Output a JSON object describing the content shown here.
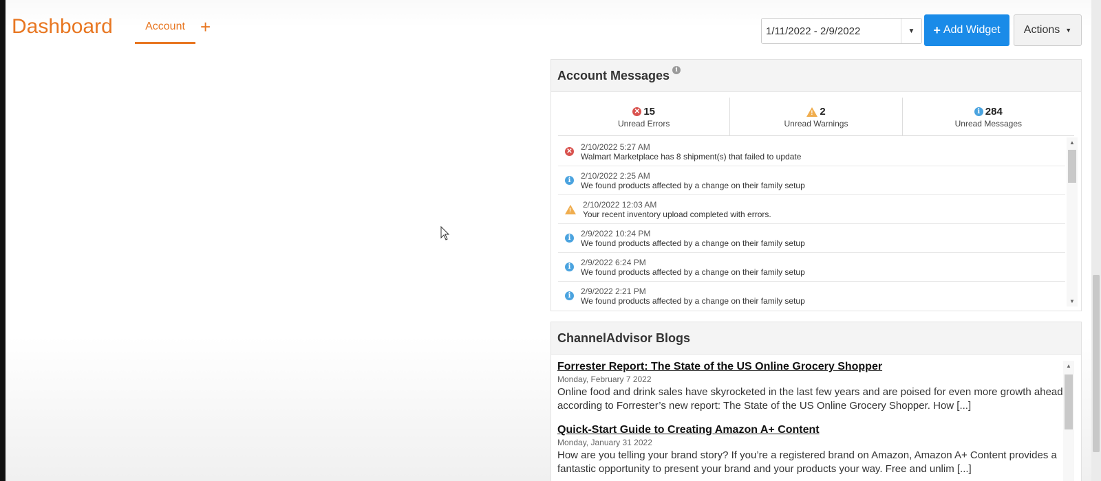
{
  "header": {
    "title": "Dashboard",
    "tab_label": "Account",
    "add_tab_symbol": "+",
    "date_range": "1/11/2022 - 2/9/2022",
    "add_widget_label": "Add Widget",
    "actions_label": "Actions"
  },
  "account_messages": {
    "title": "Account Messages",
    "stats": [
      {
        "icon": "error-icon",
        "count": "15",
        "label": "Unread Errors"
      },
      {
        "icon": "warning-icon",
        "count": "2",
        "label": "Unread Warnings"
      },
      {
        "icon": "info-icon",
        "count": "284",
        "label": "Unread Messages"
      }
    ],
    "messages": [
      {
        "type": "error",
        "date": "2/10/2022 5:27 AM",
        "text": "Walmart Marketplace has 8 shipment(s) that failed to update"
      },
      {
        "type": "info",
        "date": "2/10/2022 2:25 AM",
        "text": "We found products affected by a change on their family setup"
      },
      {
        "type": "warning",
        "date": "2/10/2022 12:03 AM",
        "text": "Your recent inventory upload completed with errors."
      },
      {
        "type": "info",
        "date": "2/9/2022 10:24 PM",
        "text": "We found products affected by a change on their family setup"
      },
      {
        "type": "info",
        "date": "2/9/2022 6:24 PM",
        "text": "We found products affected by a change on their family setup"
      },
      {
        "type": "info",
        "date": "2/9/2022 2:21 PM",
        "text": "We found products affected by a change on their family setup"
      }
    ]
  },
  "blogs": {
    "title": "ChannelAdvisor Blogs",
    "posts": [
      {
        "title": "Forrester Report: The State of the US Online Grocery Shopper",
        "date": "Monday, February 7 2022",
        "body": "Online food and drink sales have skyrocketed in the last few years and are poised for even more growth ahead, according to Forrester’s new report: The State of the US Online Grocery Shopper. How [...]"
      },
      {
        "title": "Quick-Start Guide to Creating Amazon A+ Content",
        "date": "Monday, January 31 2022",
        "body": "How are you telling your brand story? If you’re a registered brand on Amazon, Amazon A+ Content provides a fantastic opportunity to present your brand and your products your way.  Free and unlim [...]"
      }
    ]
  },
  "colors": {
    "accent_orange": "#e87722",
    "primary_blue": "#1a8be8",
    "error_red": "#d9534f",
    "warning_orange": "#f0ad4e",
    "info_blue": "#4aa3df"
  }
}
